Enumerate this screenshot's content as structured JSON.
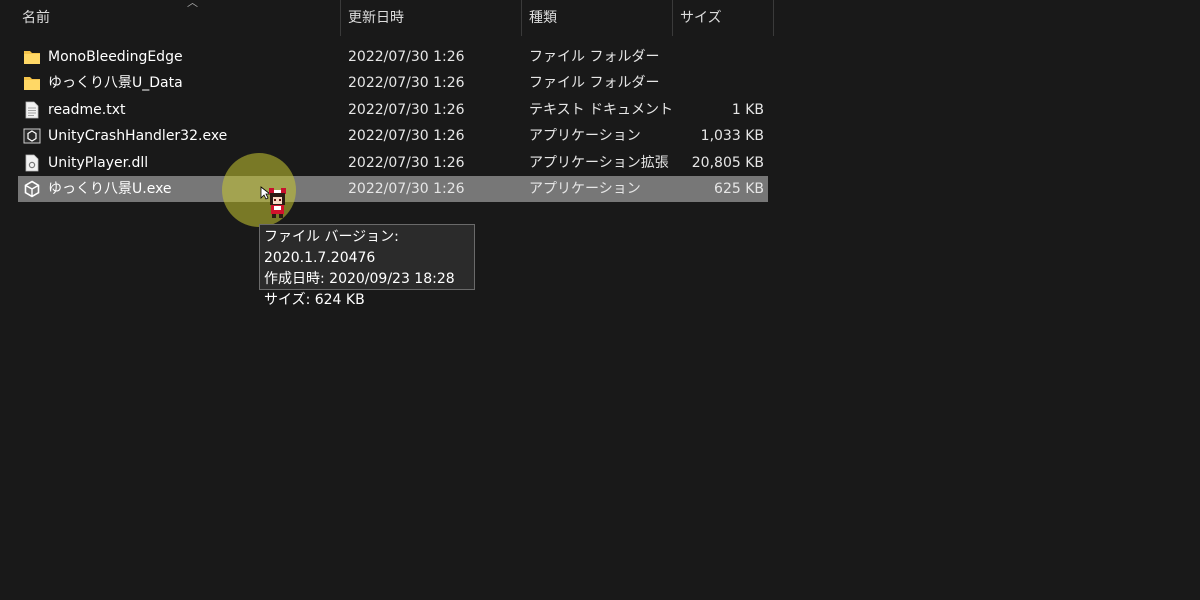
{
  "columns": {
    "name": "名前",
    "date": "更新日時",
    "type": "種類",
    "size": "サイズ"
  },
  "files": [
    {
      "name": "MonoBleedingEdge",
      "date": "2022/07/30 1:26",
      "type": "ファイル フォルダー",
      "size": "",
      "icon": "folder-icon"
    },
    {
      "name": "ゆっくり八景U_Data",
      "date": "2022/07/30 1:26",
      "type": "ファイル フォルダー",
      "size": "",
      "icon": "folder-icon"
    },
    {
      "name": "readme.txt",
      "date": "2022/07/30 1:26",
      "type": "テキスト ドキュメント",
      "size": "1 KB",
      "icon": "text-file-icon"
    },
    {
      "name": "UnityCrashHandler32.exe",
      "date": "2022/07/30 1:26",
      "type": "アプリケーション",
      "size": "1,033 KB",
      "icon": "unity-app-icon"
    },
    {
      "name": "UnityPlayer.dll",
      "date": "2022/07/30 1:26",
      "type": "アプリケーション拡張",
      "size": "20,805 KB",
      "icon": "dll-file-icon"
    },
    {
      "name": "ゆっくり八景U.exe",
      "date": "2022/07/30 1:26",
      "type": "アプリケーション",
      "size": "625 KB",
      "icon": "unity-app-icon",
      "selected": true
    }
  ],
  "tooltip": {
    "version": "ファイル バージョン: 2020.1.7.20476",
    "created": "作成日時: 2020/09/23 18:28",
    "size": "サイズ: 624 KB"
  },
  "colors": {
    "background": "#191919",
    "selection": "#777777",
    "folder": "#f4c34a",
    "cursor_highlight": "#c8c832"
  }
}
